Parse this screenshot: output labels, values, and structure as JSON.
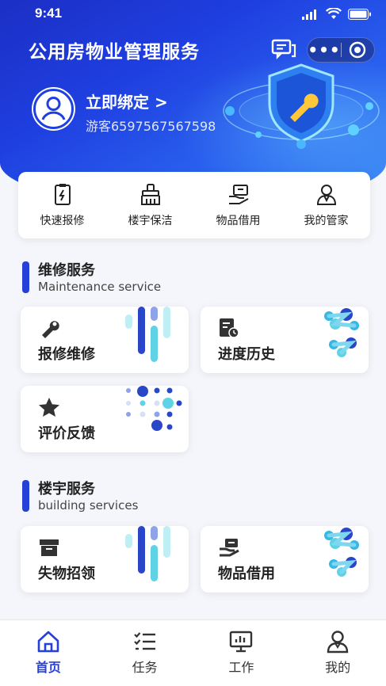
{
  "status": {
    "time": "9:41"
  },
  "header": {
    "title": "公用房物业管理服务",
    "more": "•••"
  },
  "user": {
    "bind_label": "立即绑定 >",
    "guest_id": "游客6597567567598"
  },
  "quick_actions": [
    {
      "label": "快速报修",
      "icon": "repair-report-icon"
    },
    {
      "label": "楼宇保洁",
      "icon": "cleaning-broom-icon"
    },
    {
      "label": "物品借用",
      "icon": "item-borrow-icon"
    },
    {
      "label": "我的管家",
      "icon": "butler-icon"
    }
  ],
  "sections": [
    {
      "title": "维修服务",
      "subtitle": "Maintenance service",
      "cards": [
        {
          "label": "报修维修",
          "icon": "wrench-icon"
        },
        {
          "label": "进度历史",
          "icon": "progress-history-icon"
        },
        {
          "label": "评价反馈",
          "icon": "star-icon"
        }
      ]
    },
    {
      "title": "楼宇服务",
      "subtitle": "building services",
      "cards": [
        {
          "label": "失物招领",
          "icon": "lost-found-box-icon"
        },
        {
          "label": "物品借用",
          "icon": "borrow-hand-icon"
        }
      ]
    }
  ],
  "tabs": [
    {
      "label": "首页",
      "icon": "home-icon",
      "active": true
    },
    {
      "label": "任务",
      "icon": "task-list-icon",
      "active": false
    },
    {
      "label": "工作",
      "icon": "work-monitor-icon",
      "active": false
    },
    {
      "label": "我的",
      "icon": "profile-icon",
      "active": false
    }
  ],
  "colors": {
    "primary": "#2440d8",
    "hero_start": "#1b2fc4",
    "hero_end": "#3b8cf5"
  }
}
